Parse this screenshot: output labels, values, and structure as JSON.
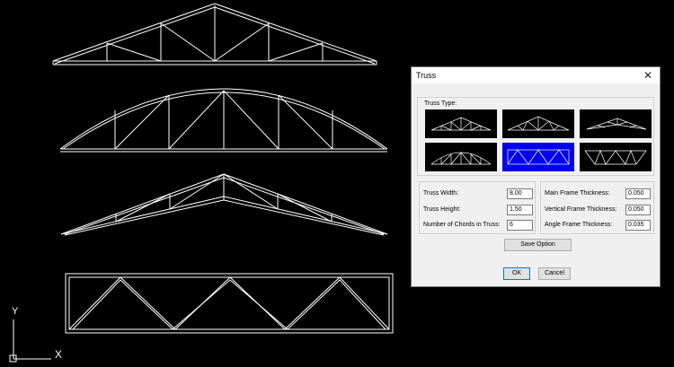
{
  "dialog": {
    "title": "Truss",
    "close_label": "✕",
    "truss_type_label": "Truss Type:",
    "selected_type_index": 4,
    "fields": {
      "truss_width": {
        "label": "Truss Width:",
        "value": "8.00"
      },
      "truss_height": {
        "label": "Truss Height:",
        "value": "1.50"
      },
      "num_chords": {
        "label": "Number of Chords in Truss:",
        "value": "6"
      },
      "main_frame_thickness": {
        "label": "Main Frame Thickness:",
        "value": "0.050"
      },
      "vertical_frame_thickness": {
        "label": "Vertical Frame Thickness:",
        "value": "0.050"
      },
      "angle_frame_thickness": {
        "label": "Angle Frame Thickness:",
        "value": "0.035"
      }
    },
    "save_option_label": "Save Option",
    "ok_label": "OK",
    "cancel_label": "Cancel"
  },
  "ucs": {
    "y_label": "Y",
    "x_label": "X"
  },
  "colors": {
    "background": "#000000",
    "lines": "#ffffff",
    "selected": "#0000ee"
  }
}
